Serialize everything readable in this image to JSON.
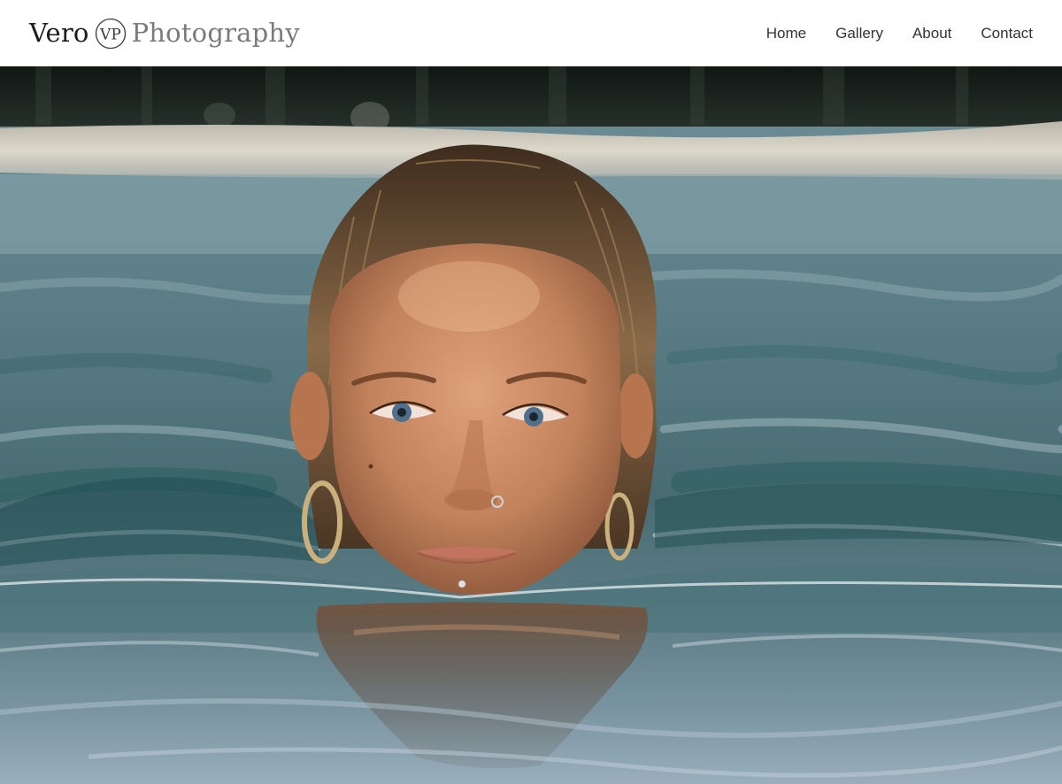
{
  "brand": {
    "first": "Vero",
    "monogram": "VP",
    "second": "Photography"
  },
  "nav": {
    "items": [
      {
        "label": "Home"
      },
      {
        "label": "Gallery"
      },
      {
        "label": "About"
      },
      {
        "label": "Contact"
      }
    ]
  },
  "hero": {
    "image_description_icon": "portrait-photo",
    "colors": {
      "water": "#587a82",
      "water_deep": "#2f5a60",
      "shore": "#d9d4c8",
      "forest": "#1a2320",
      "skin": "#c98a63",
      "hair": "#6b4a2c"
    }
  }
}
